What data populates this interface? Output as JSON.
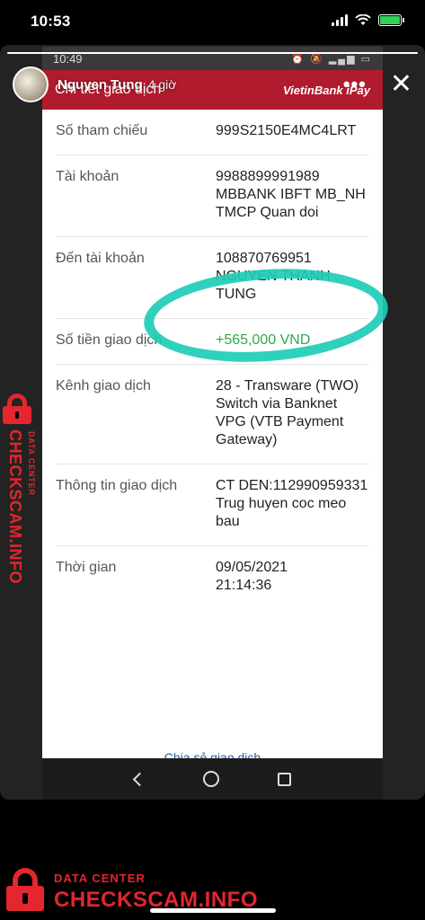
{
  "ios_status": {
    "time": "10:53"
  },
  "story": {
    "progress_fraction": 1.0,
    "username": "Nguyen Tung",
    "posted_ago": "4 giờ",
    "more_label": "•••",
    "close_label": "✕"
  },
  "screenshot": {
    "status_time": "10:49",
    "header_title": "Chi tiết giao dịch",
    "brand": "VietinBank iPay",
    "rows": [
      {
        "label": "Số tham chiếu",
        "value": "999S2150E4MC4LRT"
      },
      {
        "label": "Tài khoản",
        "value": "9988899991989 MBBANK IBFT MB_NH TMCP Quan doi"
      },
      {
        "label": "Đến tài khoản",
        "value": "108870769951 NGUYEN THANH TUNG"
      },
      {
        "label": "Số tiền giao dịch",
        "value": "+565,000 VND"
      },
      {
        "label": "Kênh giao dịch",
        "value": "28 - Transware (TWO) Switch via Banknet VPG (VTB Payment Gateway)"
      },
      {
        "label": "Thông tin giao dịch",
        "value": "CT DEN:112990959331 Trug huyen coc meo bau"
      },
      {
        "label": "Thời gian",
        "value": "09/05/2021 21:14:36"
      }
    ],
    "share_label": "Chia sẻ giao dịch"
  },
  "watermark": {
    "small": "DATA CENTER",
    "big": "CHECKSCAM.INFO"
  },
  "colors": {
    "bank_red": "#b01b2e",
    "amount_green": "#2eaa4b",
    "annotation_teal": "#1ecdb6",
    "watermark_red": "#e3262f"
  }
}
